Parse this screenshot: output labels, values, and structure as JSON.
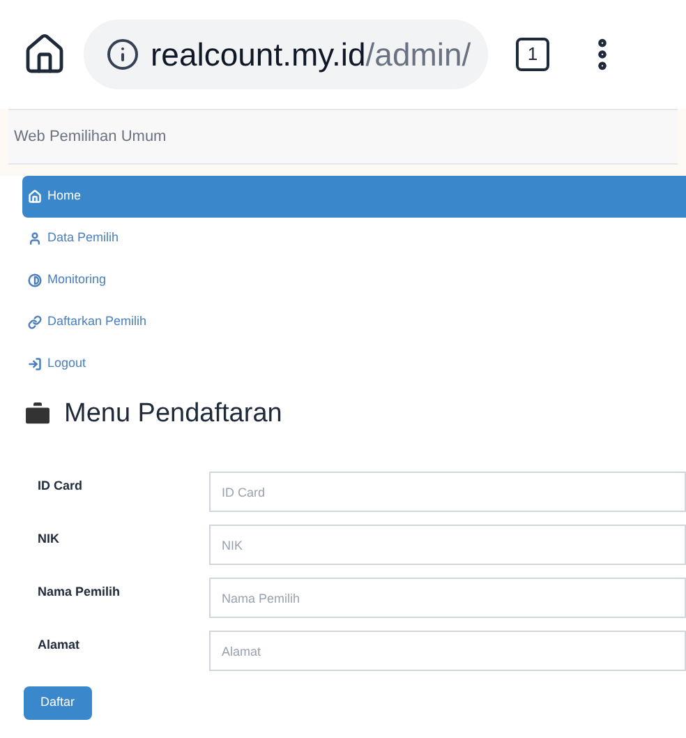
{
  "browser": {
    "url_host": "realcount.my.id",
    "url_path": "/admin/",
    "tab_count": "1"
  },
  "navbar": {
    "brand": "Web Pemilihan Umum"
  },
  "menu": [
    {
      "label": "Home",
      "kind": "home",
      "selected": true
    },
    {
      "label": "Data Pemilih",
      "kind": "user",
      "selected": false
    },
    {
      "label": "Monitoring",
      "kind": "adjust",
      "selected": false
    },
    {
      "label": "Daftarkan Pemilih",
      "kind": "link",
      "selected": false
    },
    {
      "label": "Logout",
      "kind": "logout",
      "selected": false
    }
  ],
  "heading": "Menu Pendaftaran",
  "form": {
    "fields": [
      {
        "label": "ID Card",
        "placeholder": "ID Card"
      },
      {
        "label": "NIK",
        "placeholder": "NIK"
      },
      {
        "label": "Nama Pemilih",
        "placeholder": "Nama Pemilih"
      },
      {
        "label": "Alamat",
        "placeholder": "Alamat"
      }
    ],
    "submit": "Daftar"
  }
}
